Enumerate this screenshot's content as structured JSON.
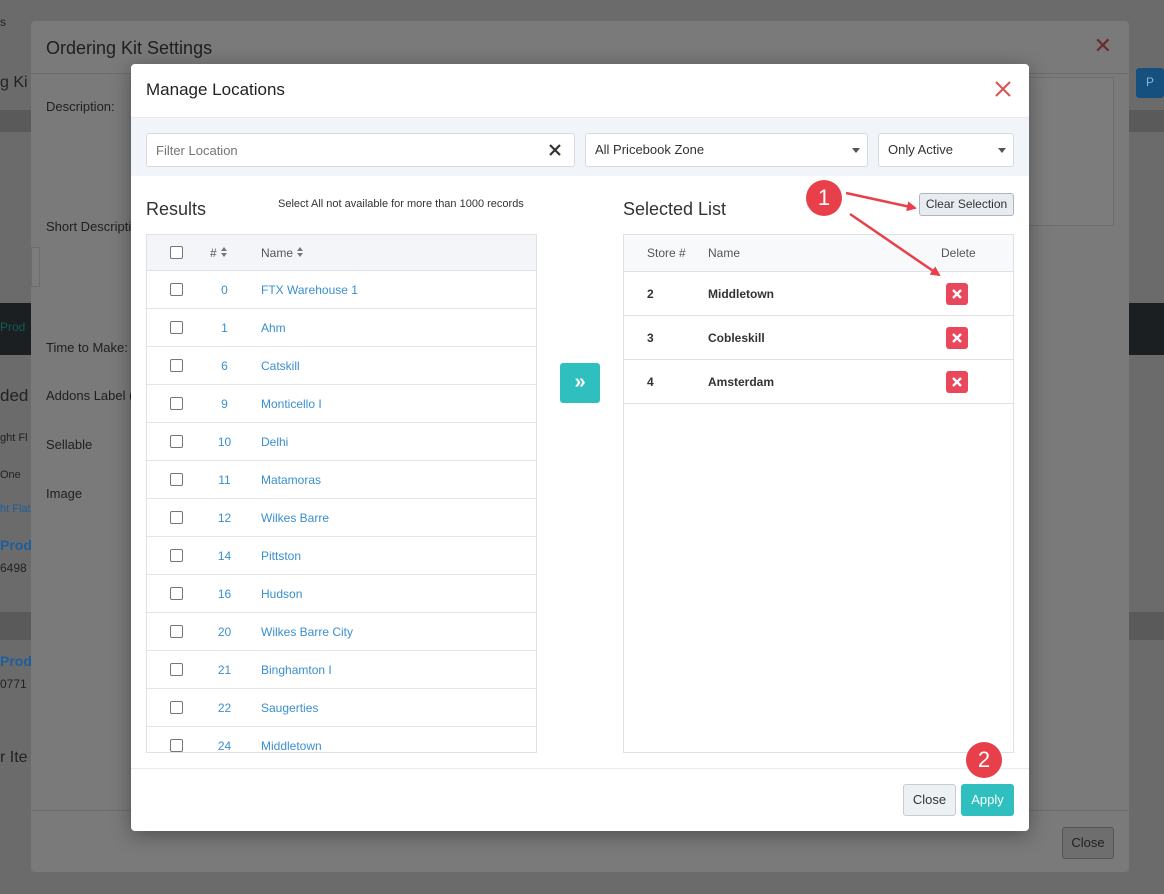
{
  "background": {
    "fragments": [
      "s",
      "g Ki",
      "Prod",
      "ded",
      "ght Fl",
      "One",
      "ht Flat",
      "Prod",
      "6498",
      "Prod",
      "0771",
      "r Ite",
      "P"
    ]
  },
  "outer_modal": {
    "title": "Ordering Kit Settings",
    "labels": [
      "Description:",
      "Short Descripti",
      "Time to Make:",
      "Addons Label (",
      "Sellable",
      "Image"
    ],
    "close_label": "Close"
  },
  "modal": {
    "title": "Manage Locations",
    "filter": {
      "placeholder": "Filter Location"
    },
    "zone_select": "All Pricebook Zone",
    "status_select": "Only Active",
    "results": {
      "title": "Results",
      "hint": "Select All not available for more than 1000 records",
      "col_num": "#",
      "col_name": "Name",
      "rows": [
        {
          "num": "0",
          "name": "FTX Warehouse 1"
        },
        {
          "num": "1",
          "name": "Ahm"
        },
        {
          "num": "6",
          "name": "Catskill"
        },
        {
          "num": "9",
          "name": "Monticello I"
        },
        {
          "num": "10",
          "name": "Delhi"
        },
        {
          "num": "11",
          "name": "Matamoras"
        },
        {
          "num": "12",
          "name": "Wilkes Barre"
        },
        {
          "num": "14",
          "name": "Pittston"
        },
        {
          "num": "16",
          "name": "Hudson"
        },
        {
          "num": "20",
          "name": "Wilkes Barre City"
        },
        {
          "num": "21",
          "name": "Binghamton I"
        },
        {
          "num": "22",
          "name": "Saugerties"
        },
        {
          "num": "24",
          "name": "Middletown"
        }
      ]
    },
    "move_icon": "double-chevron-right-icon",
    "selected": {
      "title": "Selected List",
      "clear_label": "Clear Selection",
      "col_store": "Store #",
      "col_name": "Name",
      "col_delete": "Delete",
      "rows": [
        {
          "store": "2",
          "name": "Middletown"
        },
        {
          "store": "3",
          "name": "Cobleskill"
        },
        {
          "store": "4",
          "name": "Amsterdam"
        }
      ]
    },
    "footer": {
      "close_label": "Close",
      "apply_label": "Apply"
    }
  },
  "annotations": {
    "marker1": "1",
    "marker2": "2"
  },
  "colors": {
    "accent": "#2fbfbf",
    "link": "#3a8fcf",
    "danger": "#e8475c",
    "marker": "#e8404a"
  }
}
